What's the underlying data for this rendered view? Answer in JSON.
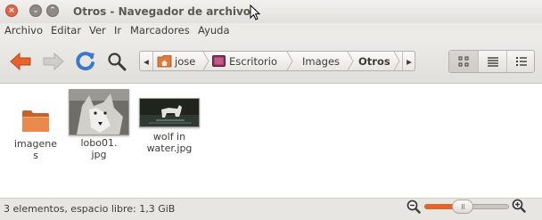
{
  "window": {
    "title": "Otros - Navegador de archivos",
    "close_glyph": "×",
    "min_glyph": "⌄",
    "max_glyph": "⌃"
  },
  "menu": [
    "Archivo",
    "Editar",
    "Ver",
    "Ir",
    "Marcadores",
    "Ayuda"
  ],
  "toolbar": {
    "icons": [
      "back-arrow-icon",
      "forward-arrow-icon",
      "reload-icon",
      "search-icon"
    ]
  },
  "pathbar": {
    "left_arrow": "◂",
    "right_arrow": "▸",
    "crumbs": [
      "jose",
      "Escritorio",
      "Images",
      "Otros"
    ],
    "active": "Otros"
  },
  "files": [
    {
      "name": "imagenes",
      "label_line1": "imagene",
      "label_line2": "s",
      "icon": "folder-icon"
    },
    {
      "name": "lobo01.jpg",
      "label_line1": "lobo01.",
      "label_line2": "jpg",
      "icon": "image-thumbnail"
    },
    {
      "name": "wolf in water.jpg",
      "label_line1": "wolf in",
      "label_line2": "water.jpg",
      "icon": "image-thumbnail"
    }
  ],
  "status": {
    "text": "3 elementos, espacio libre: 1,3 GiB",
    "zoom_level": 0.45
  },
  "colors": {
    "accent_orange": "#e8622c",
    "folder_orange": "#e07a3c",
    "reload_blue": "#3a79c9"
  }
}
